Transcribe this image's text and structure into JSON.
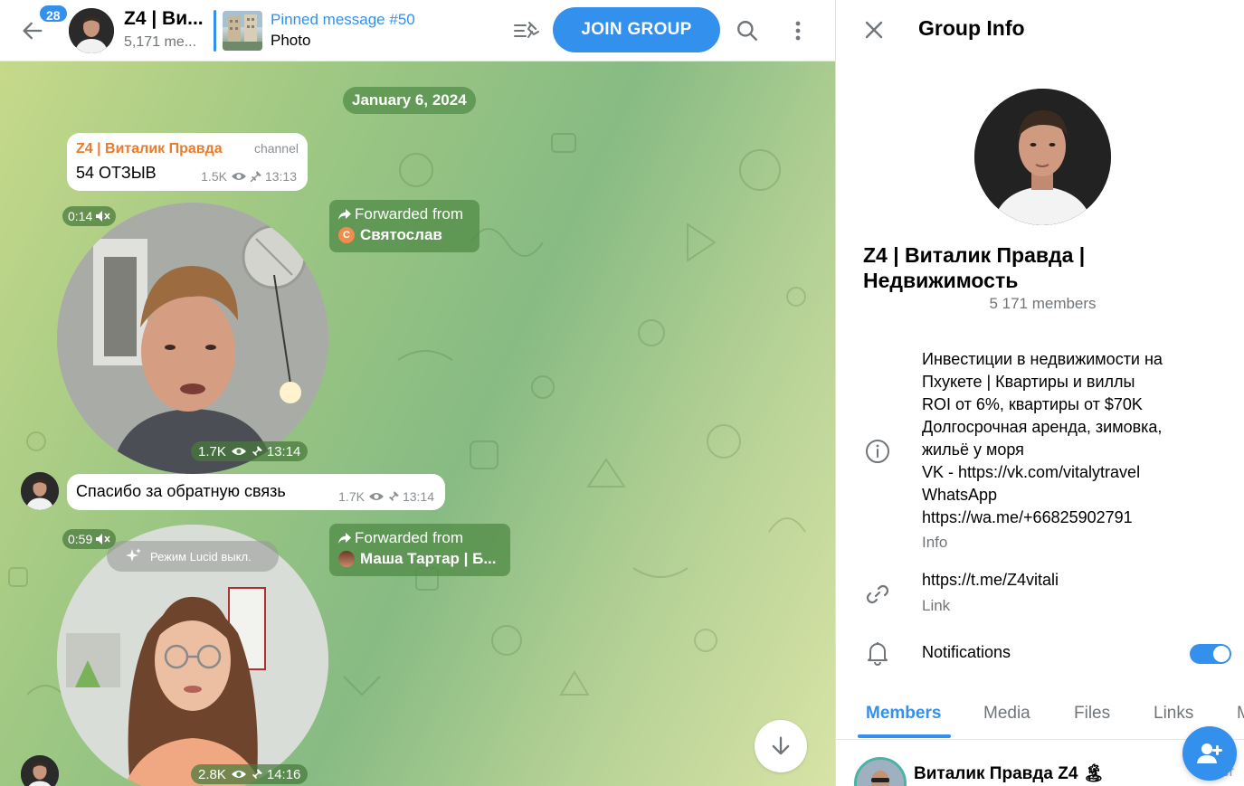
{
  "header": {
    "unread_count": "28",
    "chat_title": "Z4 | Ви...",
    "chat_subtitle": "5,171 me...",
    "pinned_title": "Pinned message #50",
    "pinned_text": "Photo",
    "join_label": "JOIN GROUP",
    "icons": [
      "back-arrow-icon",
      "pinned-list-icon",
      "search-icon",
      "more-vertical-icon"
    ]
  },
  "chat": {
    "date": "January 6, 2024",
    "messages": [
      {
        "sender": "Z4 | Виталик Правда",
        "tag": "channel",
        "text": "54 ОТЗЫВ",
        "views": "1.5K",
        "time": "13:13"
      },
      {
        "type": "video",
        "duration": "0:14",
        "forwarded_label": "Forwarded from",
        "forwarded_from": "Святослав",
        "forwarded_initial": "С",
        "views": "1.7K",
        "time": "13:14"
      },
      {
        "text": "Спасибо за обратную связь",
        "views": "1.7K",
        "time": "13:14"
      },
      {
        "type": "video",
        "duration": "0:59",
        "overlay": "Режим Lucid выкл.",
        "forwarded_label": "Forwarded from",
        "forwarded_from": "Маша Тартар | Б...",
        "views": "2.8K",
        "time": "14:16"
      }
    ]
  },
  "info": {
    "title": "Group Info",
    "group_name": "Z4 | Виталик Правда | Недвижимость",
    "members": "5 171 members",
    "description_lines": [
      "Инвестиции в недвижимости на",
      "Пхукете | Квартиры и виллы",
      "ROI от 6%, квартиры от $70K",
      "Долгосрочная аренда, зимовка,",
      "жильё у моря",
      "VK - https://vk.com/vitalytravel",
      "WhatsApp",
      "https://wa.me/+66825902791"
    ],
    "description_caption": "Info",
    "link": "https://t.me/Z4vitali",
    "link_caption": "Link",
    "notifications_label": "Notifications",
    "notifications_on": true,
    "tabs": [
      "Members",
      "Media",
      "Files",
      "Links",
      "M"
    ],
    "active_tab": "Members",
    "member_name": "Виталик Правда Z4",
    "member_emoji": "🏝",
    "member_role": "er",
    "accent": "#3390ec"
  }
}
